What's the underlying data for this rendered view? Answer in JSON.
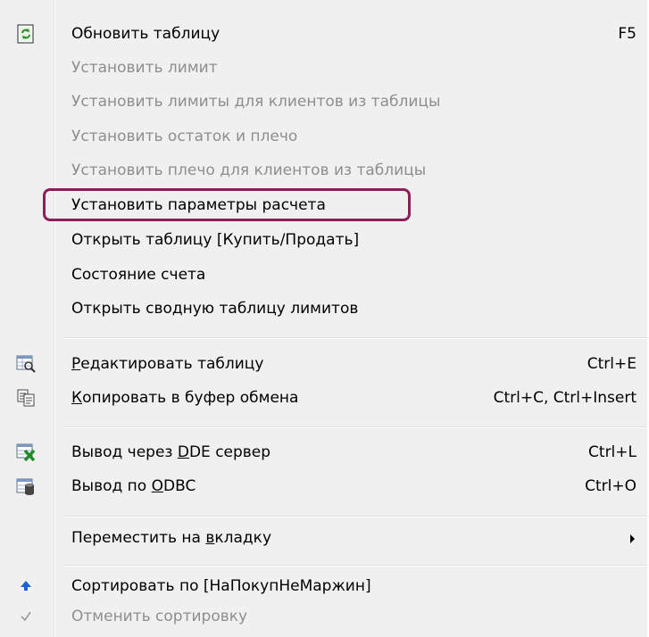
{
  "items": [
    {
      "label": "Обновить таблицу",
      "shortcut": "F5",
      "disabled": false,
      "icon": "refresh-table-icon"
    },
    {
      "label": "Установить лимит",
      "disabled": true
    },
    {
      "label": "Установить лимиты для клиентов из таблицы",
      "disabled": true
    },
    {
      "label": "Установить остаток и плечо",
      "disabled": true
    },
    {
      "label": "Установить плечо для клиентов из таблицы",
      "disabled": true
    },
    {
      "label": "Установить параметры расчета",
      "disabled": false,
      "highlighted": true
    },
    {
      "label": "Открыть таблицу [Купить/Продать]",
      "disabled": false
    },
    {
      "label": "Состояние счета",
      "disabled": false
    },
    {
      "label": "Открыть сводную таблицу лимитов",
      "disabled": false
    },
    {
      "label_pre": "",
      "label_u": "Р",
      "label_post": "едактировать таблицу",
      "shortcut": "Ctrl+E",
      "disabled": false,
      "icon": "edit-table-icon"
    },
    {
      "label_pre": "",
      "label_u": "К",
      "label_post": "опировать в буфер обмена",
      "shortcut": "Ctrl+C, Ctrl+Insert",
      "disabled": false,
      "icon": "copy-icon"
    },
    {
      "label_pre": "Вывод через ",
      "label_u": "D",
      "label_post": "DE сервер",
      "shortcut": "Ctrl+L",
      "disabled": false,
      "icon": "excel-dde-icon"
    },
    {
      "label_pre": "Вывод по ",
      "label_u": "O",
      "label_post": "DBC",
      "shortcut": "Ctrl+O",
      "disabled": false,
      "icon": "odbc-icon"
    },
    {
      "label_pre": "Переместить на ",
      "label_u": "в",
      "label_post": "кладку",
      "disabled": false,
      "submenu": true
    },
    {
      "label": "Сортировать по [НаПокупНеМаржин]",
      "disabled": false,
      "icon": "sort-up-arrow-icon"
    },
    {
      "label": "Отменить сортировку",
      "disabled": true,
      "icon": "checkmark-icon"
    }
  ],
  "colors": {
    "menu_bg": "#f0f0f0",
    "disabled_text": "#8e8e8e",
    "highlight_border": "#8b1f5a"
  }
}
